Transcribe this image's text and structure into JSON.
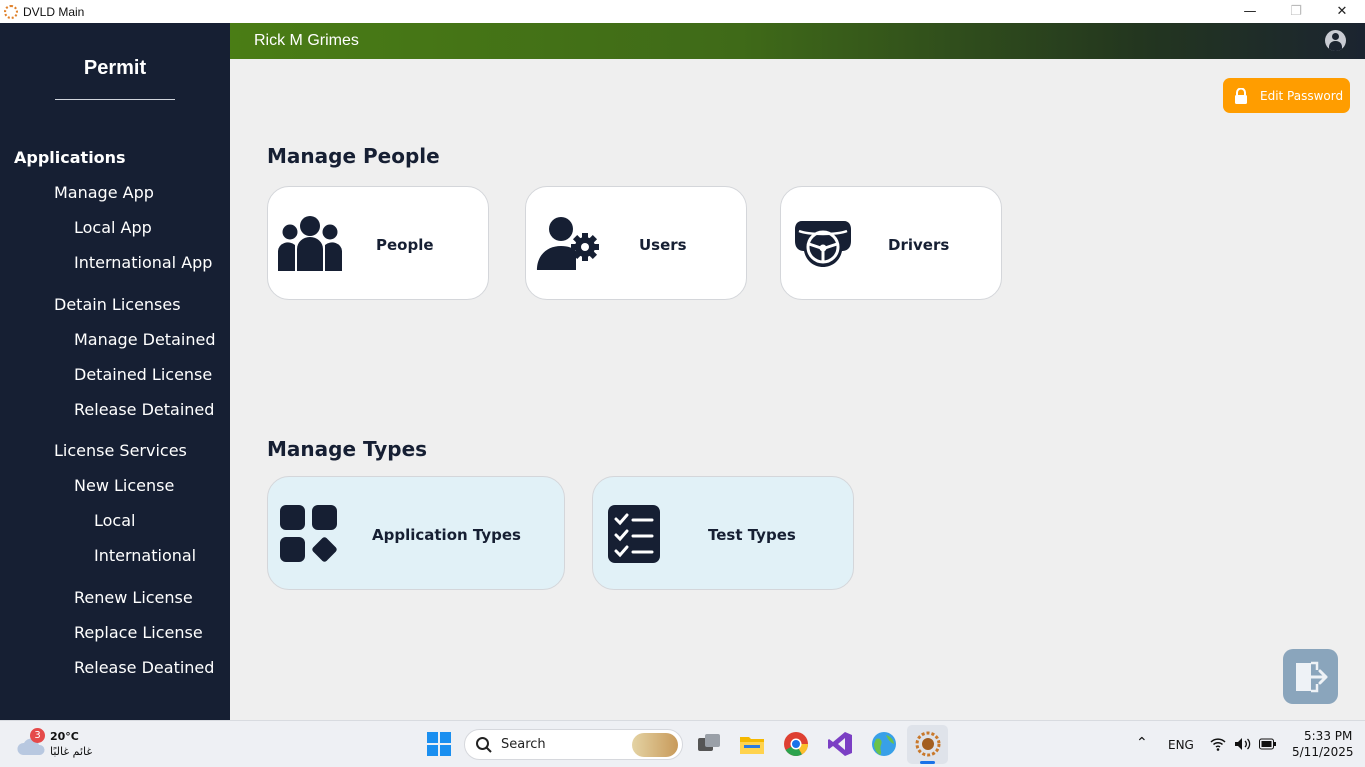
{
  "window": {
    "title": "DVLD Main",
    "minimize": "—",
    "maximize": "❐",
    "close": "✕"
  },
  "sidebar": {
    "brand": "Permit",
    "items": [
      {
        "label": "Applications"
      },
      {
        "label": "Manage App"
      },
      {
        "label": "Local App"
      },
      {
        "label": "International App"
      },
      {
        "label": "Detain Licenses"
      },
      {
        "label": "Manage Detained"
      },
      {
        "label": "Detained License"
      },
      {
        "label": "Release Detained"
      },
      {
        "label": "License Services"
      },
      {
        "label": "New License"
      },
      {
        "label": "Local"
      },
      {
        "label": "International"
      },
      {
        "label": "Renew License"
      },
      {
        "label": "Replace License"
      },
      {
        "label": "Release Deatined"
      }
    ]
  },
  "header": {
    "username": "Rick M  Grimes",
    "avatar_icon": "user-avatar-icon"
  },
  "actions": {
    "edit_password": "Edit Password",
    "edit_password_color": "#ff9d00",
    "logout_icon": "logout-door-icon"
  },
  "manage_people": {
    "title": "Manage People",
    "cards": [
      {
        "label": "People",
        "icon": "people-group-icon"
      },
      {
        "label": "Users",
        "icon": "user-gear-icon"
      },
      {
        "label": "Drivers",
        "icon": "steering-wheel-icon"
      }
    ]
  },
  "manage_types": {
    "title": "Manage Types",
    "cards": [
      {
        "label": "Application Types",
        "icon": "app-grid-icon"
      },
      {
        "label": "Test Types",
        "icon": "checklist-icon"
      }
    ]
  },
  "taskbar": {
    "weather": {
      "badge": "3",
      "temp": "20°C",
      "condition": "غائم غالبًا"
    },
    "search_label": "Search",
    "language": "ENG",
    "time": "5:33 PM",
    "date": "5/11/2025"
  },
  "colors": {
    "sidebar": "#161f33",
    "header_start": "#4a7d15",
    "type_card": "#e1f1f7",
    "page_bg": "#efefef"
  }
}
